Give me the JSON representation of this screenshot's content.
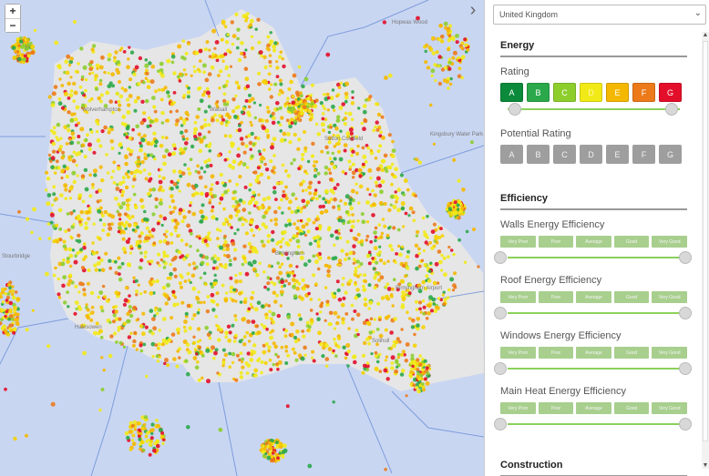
{
  "map": {
    "zoom_in": "+",
    "zoom_out": "−",
    "toggle_icon": "chevron-right-icon",
    "toggle_glyph": "›",
    "place_labels": [
      "Hopwas Wood",
      "Sutton Coldfield",
      "Kingsbury Water Park",
      "Birmingham",
      "Birmingham Airport",
      "Solihull",
      "Halesowen",
      "Stourbridge",
      "Wolverhampton",
      "Walsall"
    ],
    "colors": {
      "water": "#c9d6f2",
      "urban": "#e6e6e6",
      "boundary": "#6b8fd6"
    }
  },
  "panel": {
    "country": "United Kingdom",
    "energy": {
      "title": "Energy",
      "rating_label": "Rating",
      "grades": [
        {
          "letter": "A",
          "color": "#0a8a3a"
        },
        {
          "letter": "B",
          "color": "#2aa84a"
        },
        {
          "letter": "C",
          "color": "#8dce2d"
        },
        {
          "letter": "D",
          "color": "#f2ea16"
        },
        {
          "letter": "E",
          "color": "#f5b800"
        },
        {
          "letter": "F",
          "color": "#ec7a1a"
        },
        {
          "letter": "G",
          "color": "#e30e2a"
        }
      ],
      "potential_label": "Potential Rating",
      "potential_grades": [
        "A",
        "B",
        "C",
        "D",
        "E",
        "F",
        "G"
      ]
    },
    "efficiency": {
      "title": "Efficiency",
      "levels": [
        "Very Poor",
        "Poor",
        "Average",
        "Good",
        "Very Good"
      ],
      "groups": [
        {
          "label": "Walls Energy Efficiency"
        },
        {
          "label": "Roof Energy Efficiency"
        },
        {
          "label": "Windows Energy Efficiency"
        },
        {
          "label": "Main Heat Energy Efficiency"
        }
      ]
    },
    "next_section": "Construction"
  }
}
